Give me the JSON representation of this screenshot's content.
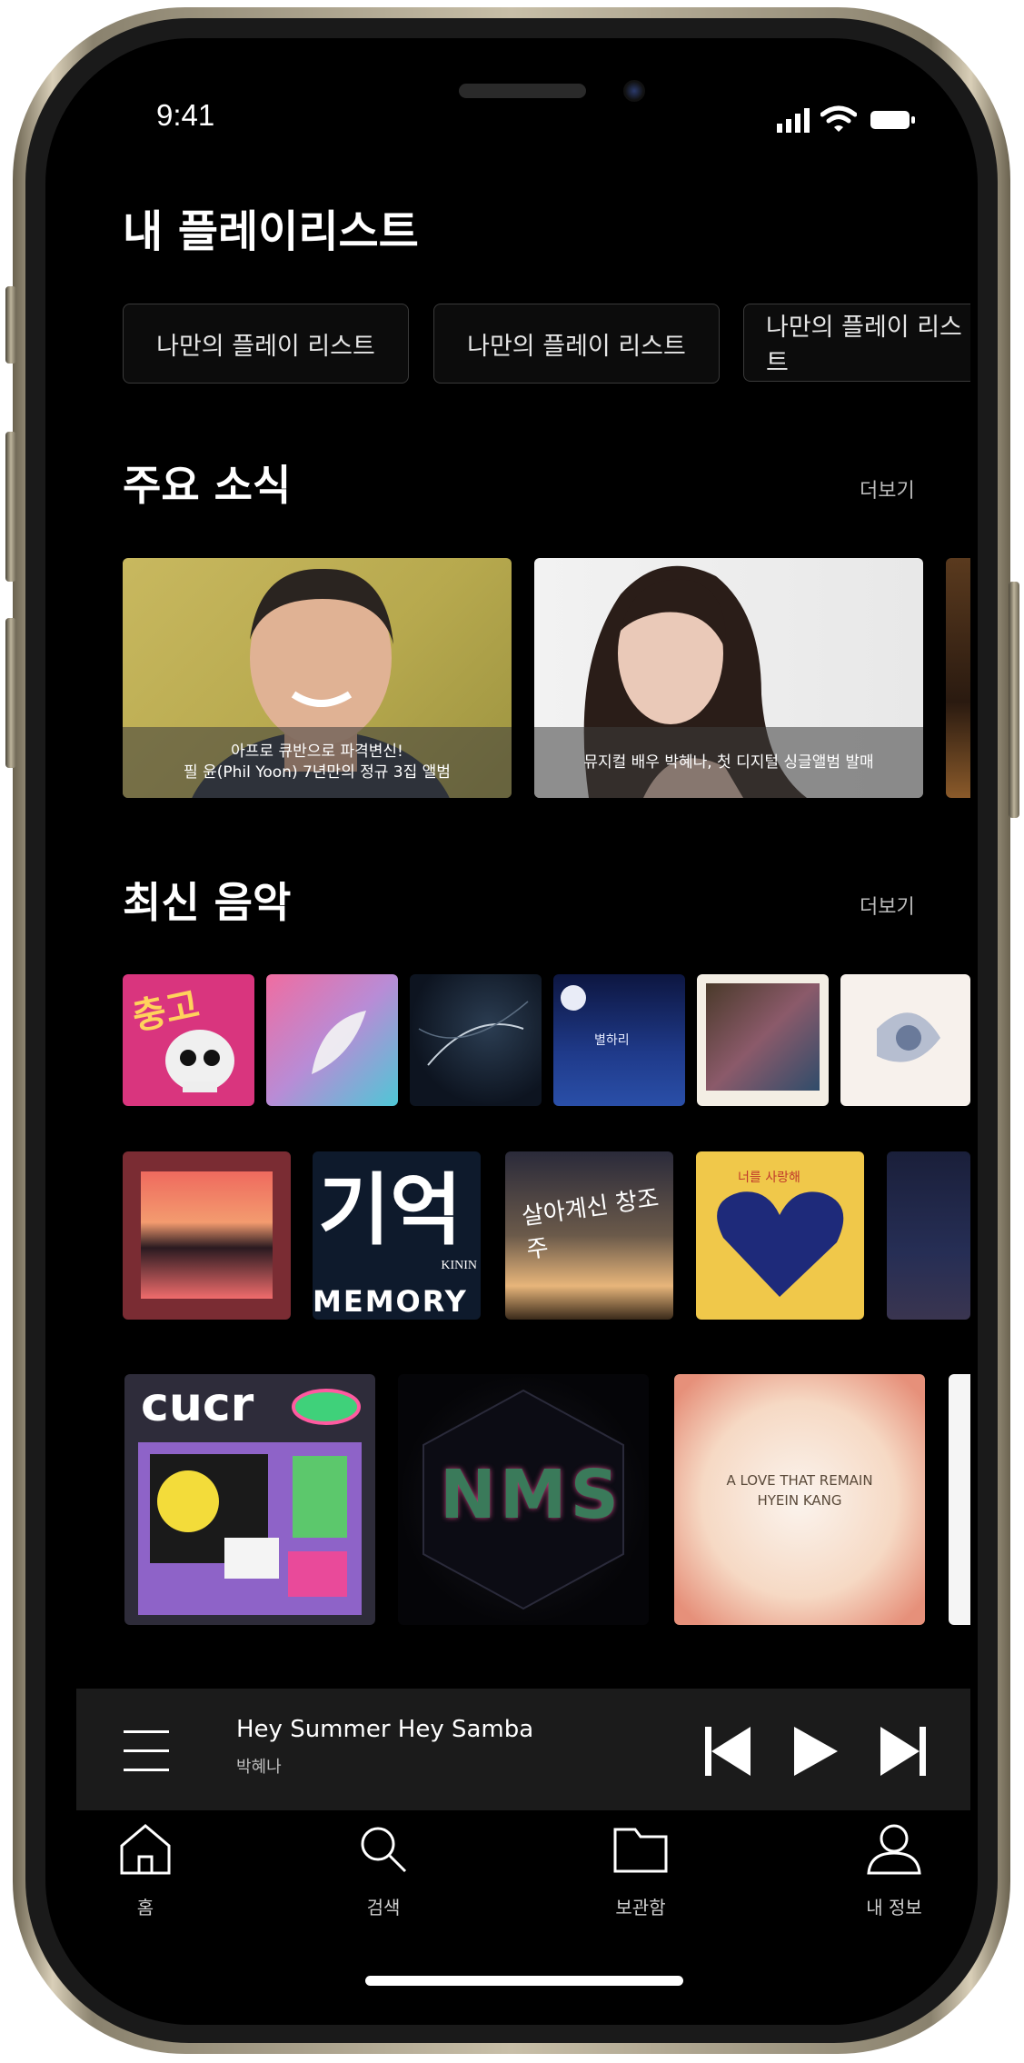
{
  "status_bar": {
    "time": "9:41"
  },
  "header": {
    "title": "내 플레이리스트"
  },
  "playlists": [
    {
      "label": "나만의 플레이 리스트"
    },
    {
      "label": "나만의 플레이 리스트"
    },
    {
      "label": "나만의 플레이 리스트"
    }
  ],
  "news": {
    "title": "주요 소식",
    "more": "더보기",
    "items": [
      {
        "line1": "아프로 큐반으로 파격변신!",
        "line2": "필 윤(Phil Yoon) 7년만의 정규 3집 앨범"
      },
      {
        "line1": "뮤지컬 배우 박혜나, 첫 디지털 싱글앨범 발매",
        "line2": ""
      }
    ]
  },
  "latest": {
    "title": "최신 음악",
    "more": "더보기",
    "album_art_text": {
      "a1": "충고",
      "a4": "별하리",
      "a8": "기억",
      "a8_sub": "KININ",
      "a8_bottom": "MEMORY",
      "a9": "살아계신 창조주",
      "a11": "너를 사랑해",
      "a13": "cucr",
      "a14": "NMS",
      "a15_line1": "A LOVE THAT REMAIN",
      "a15_line2": "HYEIN KANG"
    }
  },
  "player": {
    "title": "Hey Summer Hey Samba",
    "artist": "박혜나"
  },
  "tabbar": [
    {
      "label": "홈"
    },
    {
      "label": "검색"
    },
    {
      "label": "보관함"
    },
    {
      "label": "내 정보"
    }
  ]
}
